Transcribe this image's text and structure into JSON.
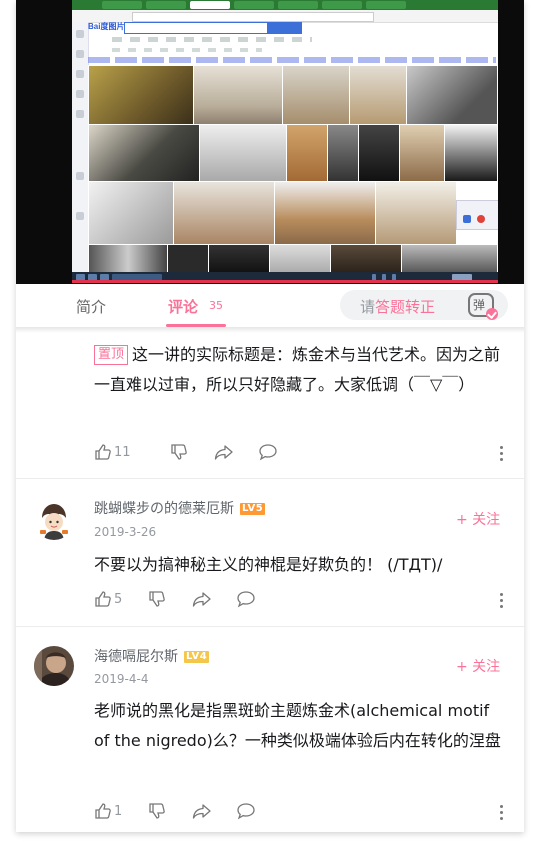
{
  "tabs": {
    "intro_label": "简介",
    "comments_label": "评论",
    "comments_count": "35"
  },
  "danmu": {
    "prefix": "请",
    "highlight": "答题转正",
    "button_glyph": "弹"
  },
  "comments": [
    {
      "pinned_label": "置顶",
      "text": "这一讲的实际标题是：炼金术与当代艺术。因为之前一直难以过审，所以只好隐藏了。大家低调（￣▽￣）",
      "likes": "11"
    },
    {
      "username": "跳蝴蝶步の的德莱厄斯",
      "level": "LV5",
      "date": "2019-3-26",
      "follow_label": "+ 关注",
      "text": "不要以为搞神秘主义的神棍是好欺负的！ (/TДT)/",
      "likes": "5"
    },
    {
      "username": "海德嗝屁尔斯",
      "level": "LV4",
      "date": "2019-4-4",
      "follow_label": "+ 关注",
      "text": "老师说的黑化是指黑斑蚧主题炼金术(alchemical motif of the nigredo)么？一种类似极端体验后内在转化的涅盘",
      "likes": "1"
    }
  ],
  "video": {
    "search_logo": "Bai度图片",
    "colors": {
      "accent": "#fb7299",
      "progress": "#e3324d"
    }
  }
}
